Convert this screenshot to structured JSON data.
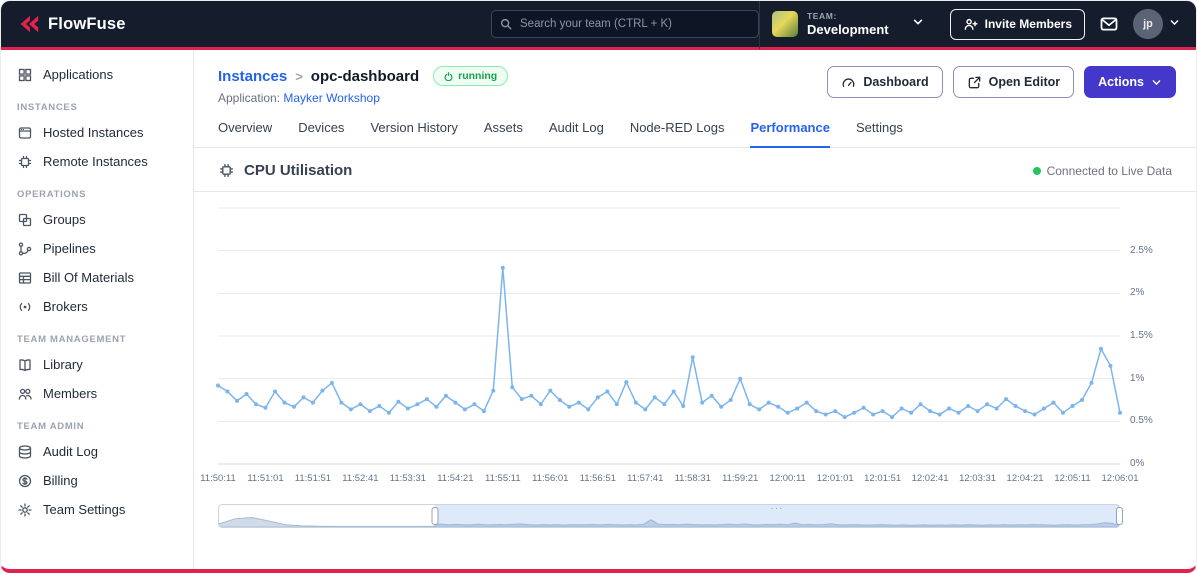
{
  "colors": {
    "brand_red": "#E2224E",
    "navbar_bg": "#151d2c",
    "link_blue": "#2563EB",
    "primary_indigo": "#4338CA",
    "series_blue": "#7CB5EC",
    "status_green": "#22C55E"
  },
  "navbar": {
    "brand": "FlowFuse",
    "search": {
      "placeholder": "Search your team (CTRL + K)"
    },
    "team": {
      "label": "TEAM:",
      "name": "Development"
    },
    "invite_button": "Invite Members",
    "avatar_initials": "jp"
  },
  "sidebar": {
    "sections": [
      {
        "title": "",
        "items": [
          {
            "label": "Applications"
          }
        ]
      },
      {
        "title": "INSTANCES",
        "items": [
          {
            "label": "Hosted Instances"
          },
          {
            "label": "Remote Instances"
          }
        ]
      },
      {
        "title": "OPERATIONS",
        "items": [
          {
            "label": "Groups"
          },
          {
            "label": "Pipelines"
          },
          {
            "label": "Bill Of Materials"
          },
          {
            "label": "Brokers"
          }
        ]
      },
      {
        "title": "TEAM MANAGEMENT",
        "items": [
          {
            "label": "Library"
          },
          {
            "label": "Members"
          }
        ]
      },
      {
        "title": "TEAM ADMIN",
        "items": [
          {
            "label": "Audit Log"
          },
          {
            "label": "Billing"
          },
          {
            "label": "Team Settings"
          }
        ]
      }
    ]
  },
  "header": {
    "breadcrumb_root": "Instances",
    "breadcrumb_separator": ">",
    "instance_name": "opc-dashboard",
    "status": "running",
    "application_label": "Application:",
    "application_name": "Mayker Workshop",
    "buttons": {
      "dashboard": "Dashboard",
      "open_editor": "Open Editor",
      "actions": "Actions"
    }
  },
  "tabs": [
    {
      "label": "Overview",
      "active": false
    },
    {
      "label": "Devices",
      "active": false
    },
    {
      "label": "Version History",
      "active": false
    },
    {
      "label": "Assets",
      "active": false
    },
    {
      "label": "Audit Log",
      "active": false
    },
    {
      "label": "Node-RED Logs",
      "active": false
    },
    {
      "label": "Performance",
      "active": true
    },
    {
      "label": "Settings",
      "active": false
    }
  ],
  "performance": {
    "section_title": "CPU Utilisation",
    "live_status": "Connected to Live Data"
  },
  "chart_data": {
    "type": "line",
    "title": "CPU Utilisation",
    "series_color": "#7CB5EC",
    "ylim": [
      0,
      3
    ],
    "grid_values": [
      0,
      0.5,
      1,
      1.5,
      2,
      2.5,
      3
    ],
    "yticks": [
      {
        "label": "0%",
        "value": 0
      },
      {
        "label": "0.5%",
        "value": 0.5
      },
      {
        "label": "1%",
        "value": 1
      },
      {
        "label": "1.5%",
        "value": 1.5
      },
      {
        "label": "2%",
        "value": 2
      },
      {
        "label": "2.5%",
        "value": 2.5
      }
    ],
    "x_tick_labels": [
      "11:50:11",
      "11:51:01",
      "11:51:51",
      "11:52:41",
      "11:53:31",
      "11:54:21",
      "11:55:11",
      "11:56:01",
      "11:56:51",
      "11:57:41",
      "11:58:31",
      "11:59:21",
      "12:00:11",
      "12:01:01",
      "12:01:51",
      "12:02:41",
      "12:03:31",
      "12:04:21",
      "12:05:11",
      "12:06:01"
    ],
    "values": [
      0.92,
      0.85,
      0.74,
      0.82,
      0.7,
      0.66,
      0.85,
      0.72,
      0.67,
      0.78,
      0.72,
      0.86,
      0.95,
      0.72,
      0.64,
      0.7,
      0.62,
      0.68,
      0.6,
      0.73,
      0.65,
      0.7,
      0.76,
      0.67,
      0.8,
      0.72,
      0.64,
      0.7,
      0.62,
      0.86,
      2.3,
      0.9,
      0.76,
      0.8,
      0.7,
      0.86,
      0.75,
      0.67,
      0.72,
      0.64,
      0.78,
      0.85,
      0.7,
      0.96,
      0.72,
      0.64,
      0.78,
      0.7,
      0.85,
      0.68,
      1.25,
      0.72,
      0.8,
      0.67,
      0.75,
      1.0,
      0.7,
      0.64,
      0.72,
      0.67,
      0.6,
      0.65,
      0.72,
      0.62,
      0.58,
      0.62,
      0.55,
      0.6,
      0.66,
      0.58,
      0.62,
      0.55,
      0.65,
      0.6,
      0.7,
      0.62,
      0.58,
      0.65,
      0.6,
      0.68,
      0.62,
      0.7,
      0.65,
      0.76,
      0.68,
      0.62,
      0.58,
      0.65,
      0.72,
      0.6,
      0.68,
      0.75,
      0.95,
      1.35,
      1.15,
      0.6
    ]
  },
  "minimap": {
    "selection_start_pct": 24,
    "selection_end_pct": 100,
    "ymax": 6,
    "pre_values": [
      1.0,
      2.6,
      3.0,
      1.9,
      0.7,
      0.35,
      0.25,
      0.2,
      0.2,
      0.18,
      0.18,
      0.2,
      0.2,
      0.2
    ]
  }
}
